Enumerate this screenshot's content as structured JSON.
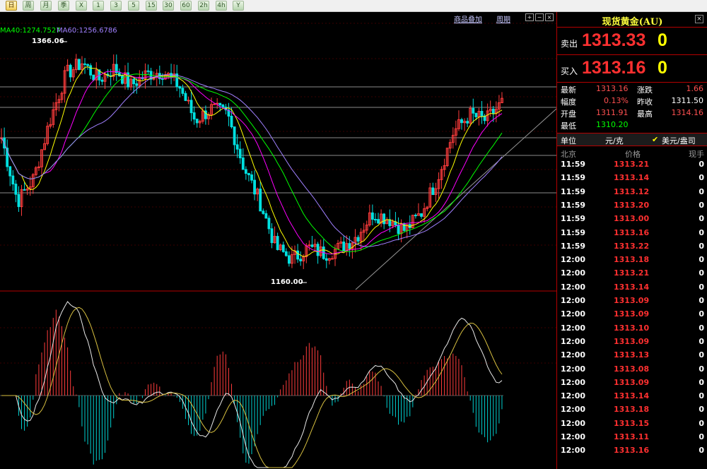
{
  "toolbar": {
    "buttons": [
      "日",
      "周",
      "月",
      "季",
      "X",
      "1",
      "3",
      "5",
      "15",
      "30",
      "60",
      "2h",
      "4h",
      "Y"
    ]
  },
  "chart": {
    "ma40_label": "MA40:1274.7527",
    "ma60_label": "MA60:1256.6786",
    "overlay_link": "商品叠加",
    "period_link": "周期",
    "high_marker": "1366.06",
    "low_marker": "1160.00",
    "colors": {
      "up_candle": "#ff3c3c",
      "down_candle": "#00e0e0",
      "ma40": "#00ff00",
      "ma60": "#a080ff",
      "ma_yellow": "#ffff00",
      "ma_magenta": "#ff00ff",
      "hist_up": "#ff3c3c",
      "hist_down": "#00d0d0"
    }
  },
  "chart_data": {
    "type": "candlestick",
    "price_high": 1366.06,
    "price_low": 1160.0,
    "close_path": [
      1285,
      1230,
      1250,
      1300,
      1340,
      1350,
      1335,
      1345,
      1330,
      1340,
      1342,
      1330,
      1300,
      1310,
      1305,
      1260,
      1230,
      1190,
      1180,
      1190,
      1185,
      1190,
      1200,
      1220,
      1215,
      1205,
      1220,
      1250,
      1290,
      1305,
      1300,
      1315
    ],
    "ma40_last": 1274.7527,
    "ma60_last": 1256.6786,
    "indicator": "macd"
  },
  "quote": {
    "title": "现货黄金(AU)",
    "close_label": "×",
    "sell_label": "卖出",
    "sell_price": "1313.33",
    "sell_vol": "0",
    "buy_label": "买入",
    "buy_price": "1313.16",
    "buy_vol": "0",
    "stats": {
      "latest_label": "最新",
      "latest": "1313.16",
      "change_label": "涨跌",
      "change": "1.66",
      "amp_label": "幅度",
      "amp": "0.13%",
      "prev_label": "昨收",
      "prev": "1311.50",
      "open_label": "开盘",
      "open": "1311.91",
      "high_label": "最高",
      "high": "1314.16",
      "low_label": "最低",
      "low": "1310.20"
    },
    "unit_label": "单位",
    "unit_yuan": "元/克",
    "unit_usd": "美元/盎司",
    "col_time": "北京",
    "col_price": "价格",
    "col_vol": "现手",
    "ticks": [
      {
        "time": "11:59",
        "price": "1313.21",
        "vol": "0"
      },
      {
        "time": "11:59",
        "price": "1313.14",
        "vol": "0"
      },
      {
        "time": "11:59",
        "price": "1313.12",
        "vol": "0"
      },
      {
        "time": "11:59",
        "price": "1313.20",
        "vol": "0"
      },
      {
        "time": "11:59",
        "price": "1313.00",
        "vol": "0"
      },
      {
        "time": "11:59",
        "price": "1313.16",
        "vol": "0"
      },
      {
        "time": "11:59",
        "price": "1313.22",
        "vol": "0"
      },
      {
        "time": "12:00",
        "price": "1313.18",
        "vol": "0"
      },
      {
        "time": "12:00",
        "price": "1313.21",
        "vol": "0"
      },
      {
        "time": "12:00",
        "price": "1313.14",
        "vol": "0"
      },
      {
        "time": "12:00",
        "price": "1313.09",
        "vol": "0"
      },
      {
        "time": "12:00",
        "price": "1313.09",
        "vol": "0"
      },
      {
        "time": "12:00",
        "price": "1313.10",
        "vol": "0"
      },
      {
        "time": "12:00",
        "price": "1313.09",
        "vol": "0"
      },
      {
        "time": "12:00",
        "price": "1313.13",
        "vol": "0"
      },
      {
        "time": "12:00",
        "price": "1313.08",
        "vol": "0"
      },
      {
        "time": "12:00",
        "price": "1313.09",
        "vol": "0"
      },
      {
        "time": "12:00",
        "price": "1313.14",
        "vol": "0"
      },
      {
        "time": "12:00",
        "price": "1313.18",
        "vol": "0"
      },
      {
        "time": "12:00",
        "price": "1313.15",
        "vol": "0"
      },
      {
        "time": "12:00",
        "price": "1313.11",
        "vol": "0"
      },
      {
        "time": "12:00",
        "price": "1313.16",
        "vol": "0"
      }
    ]
  }
}
